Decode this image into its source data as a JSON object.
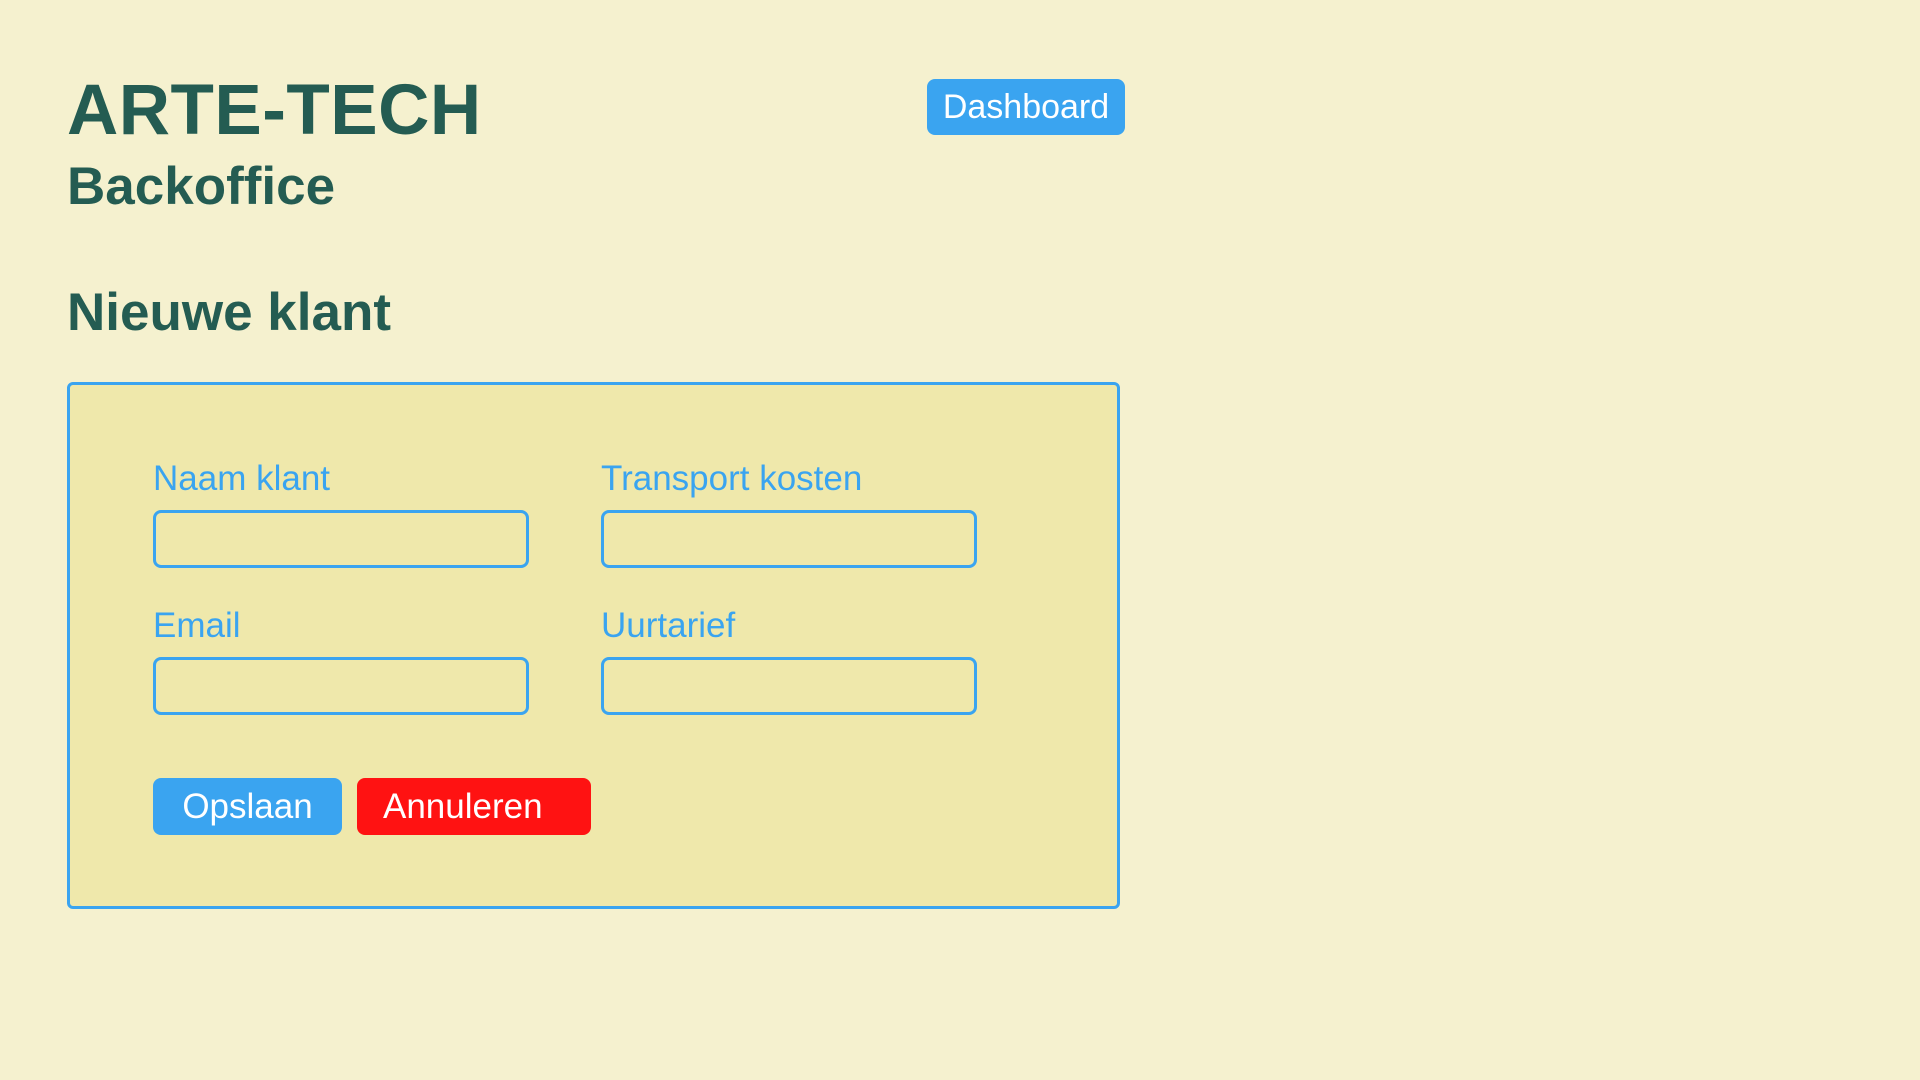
{
  "header": {
    "brand_title": "ARTE-TECH",
    "brand_subtitle": "Backoffice",
    "dashboard_label": "Dashboard"
  },
  "page": {
    "title": "Nieuwe klant"
  },
  "form": {
    "fields": [
      {
        "label": "Naam klant",
        "value": "",
        "placeholder": ""
      },
      {
        "label": "Transport kosten",
        "value": "",
        "placeholder": ""
      },
      {
        "label": "Email",
        "value": "",
        "placeholder": ""
      },
      {
        "label": "Uurtarief",
        "value": "",
        "placeholder": ""
      }
    ],
    "save_label": "Opslaan",
    "cancel_label": "Annuleren"
  },
  "colors": {
    "background": "#f5f1cf",
    "panel": "#efe8ab",
    "heading": "#245c52",
    "accent": "#3aa4f0",
    "danger": "#ff1212"
  }
}
